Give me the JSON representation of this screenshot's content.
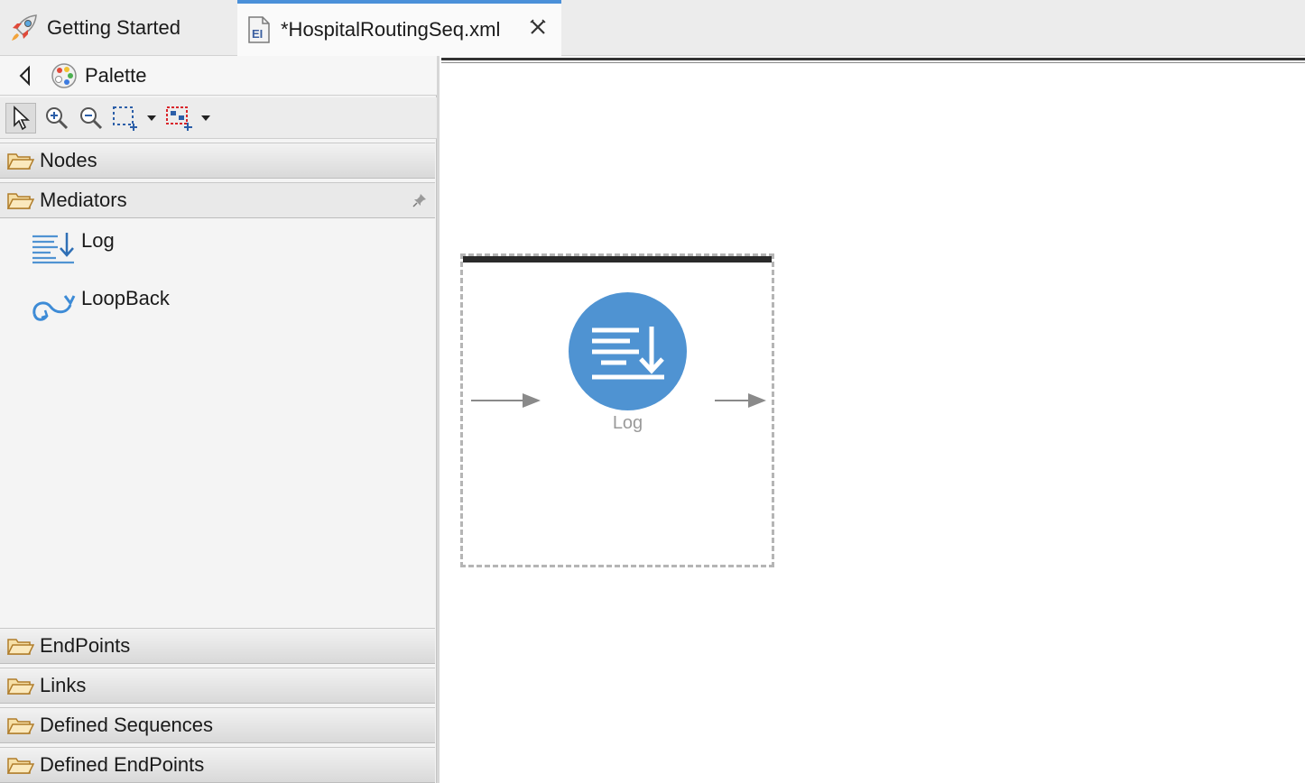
{
  "tabs": [
    {
      "label": "Getting Started",
      "icon": "rocket-icon"
    },
    {
      "label": "*HospitalRoutingSeq.xml",
      "icon": "ei-file-icon",
      "active": true
    }
  ],
  "palette": {
    "title": "Palette",
    "drawers": {
      "nodes": "Nodes",
      "mediators": "Mediators",
      "endpoints": "EndPoints",
      "links": "Links",
      "defined_sequences": "Defined Sequences",
      "defined_endpoints": "Defined EndPoints"
    },
    "mediator_items": [
      {
        "label": "Log",
        "icon": "log-mediator-icon"
      },
      {
        "label": "LoopBack",
        "icon": "loopback-icon"
      }
    ]
  },
  "canvas": {
    "node_label": "Log"
  },
  "colors": {
    "accent": "#4a90d9",
    "log_node": "#4f93d2",
    "folder": "#d9a84a"
  }
}
